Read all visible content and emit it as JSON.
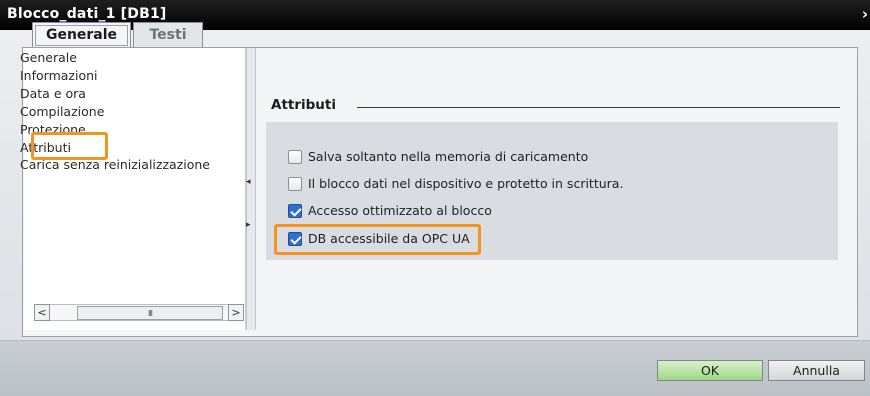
{
  "window": {
    "title": "Blocco_dati_1 [DB1]",
    "close_glyph": "›"
  },
  "tabs": [
    {
      "label": "Generale",
      "selected": true
    },
    {
      "label": "Testi",
      "selected": false
    }
  ],
  "nav": {
    "items": [
      {
        "label": "Generale"
      },
      {
        "label": "Informazioni"
      },
      {
        "label": "Data e ora"
      },
      {
        "label": "Compilazione"
      },
      {
        "label": "Protezione"
      },
      {
        "label": "Attributi",
        "selected": true
      },
      {
        "label": "Carica senza reinizializzazione"
      }
    ],
    "scroll_left": "<",
    "scroll_right": ">",
    "scroll_thumb": "III"
  },
  "splitter": {
    "arrow_left": "◂",
    "arrow_right": "▸"
  },
  "section": {
    "title": "Attributi"
  },
  "attributes": [
    {
      "label": "Salva soltanto nella memoria di caricamento",
      "checked": false
    },
    {
      "label": "Il blocco dati nel dispositivo e protetto in scrittura.",
      "checked": false
    },
    {
      "label": "Accesso ottimizzato al blocco",
      "checked": true
    },
    {
      "label": "DB accessibile da OPC UA",
      "checked": true
    }
  ],
  "footer": {
    "ok_label": "OK",
    "cancel_label": "Annulla"
  },
  "colors": {
    "highlight": "#f39321",
    "checkbox_checked": "#2e6fd0",
    "ok_button": "#9dd987"
  }
}
